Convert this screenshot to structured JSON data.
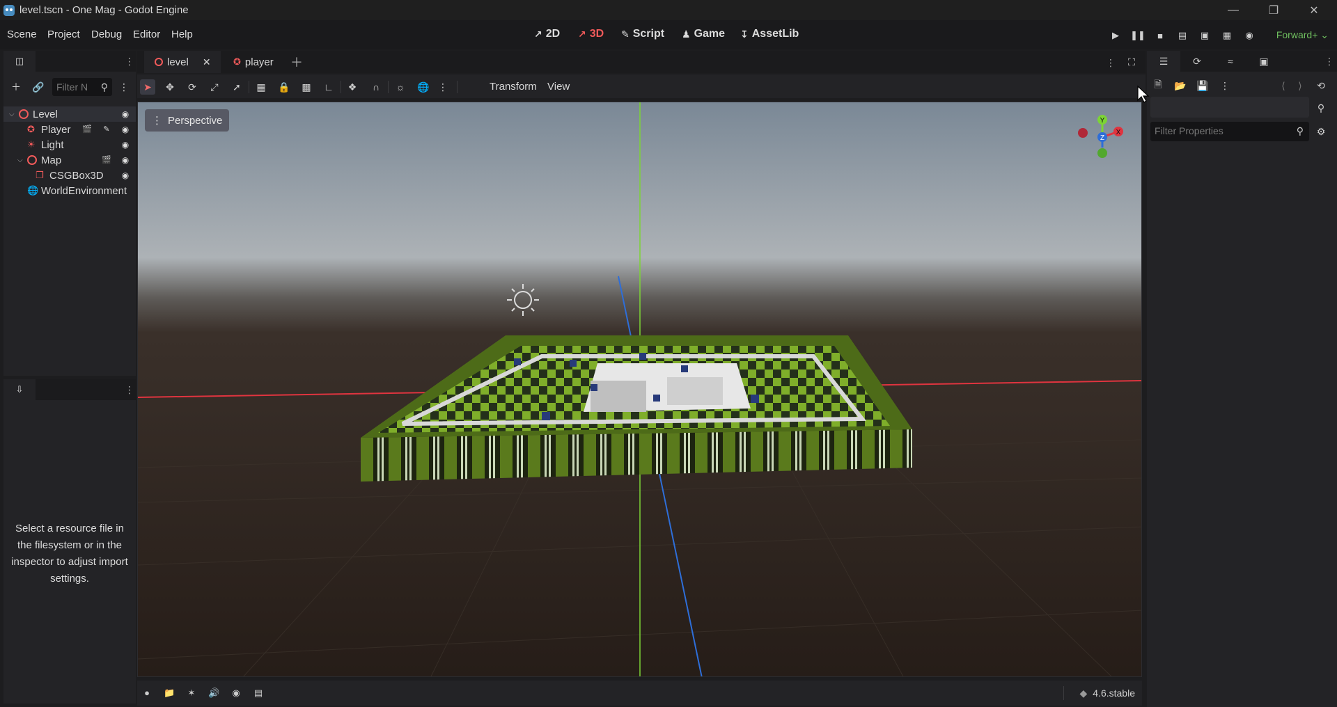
{
  "window": {
    "title": "level.tscn - One Mag - Godot Engine",
    "controls": [
      "minimize",
      "maximize",
      "close"
    ]
  },
  "menu": {
    "items": [
      "Scene",
      "Project",
      "Debug",
      "Editor",
      "Help"
    ]
  },
  "workspaces": [
    {
      "label": "2D",
      "icon": "2d-icon",
      "active": false
    },
    {
      "label": "3D",
      "icon": "3d-icon",
      "active": true
    },
    {
      "label": "Script",
      "icon": "script-icon",
      "active": false
    },
    {
      "label": "Game",
      "icon": "game-icon",
      "active": false
    },
    {
      "label": "AssetLib",
      "icon": "assetlib-icon",
      "active": false
    }
  ],
  "renderer": "Forward+",
  "scene_dock": {
    "filter_placeholder": "Filter N",
    "tree": [
      {
        "name": "Level",
        "icon": "node3d-icon",
        "expanded": true,
        "depth": 0
      },
      {
        "name": "Player",
        "icon": "character-icon",
        "depth": 1
      },
      {
        "name": "Light",
        "icon": "light-icon",
        "depth": 1
      },
      {
        "name": "Map",
        "icon": "node3d-icon",
        "expanded": true,
        "depth": 1
      },
      {
        "name": "CSGBox3D",
        "icon": "csgbox-icon",
        "depth": 2
      },
      {
        "name": "WorldEnvironment",
        "icon": "environment-icon",
        "depth": 1
      }
    ]
  },
  "import_dock": {
    "message": "Select a resource file in the filesystem or in the inspector to adjust import settings."
  },
  "editor_tabs": [
    {
      "label": "level",
      "active": true
    },
    {
      "label": "player",
      "active": false
    }
  ],
  "viewport_toolbar": {
    "transform_label": "Transform",
    "view_label": "View"
  },
  "viewport": {
    "perspective_label": "Perspective",
    "gizmo": {
      "y": "Y",
      "x": "X",
      "z": "Z"
    }
  },
  "inspector": {
    "filter_placeholder": "Filter Properties"
  },
  "status": {
    "version": "4.6.stable"
  },
  "colors": {
    "accent_red": "#f05a5a",
    "renderer_green": "#6fbf5f",
    "axis_x": "#e0343f",
    "axis_y": "#7cd435",
    "axis_z": "#2e6ed8"
  }
}
